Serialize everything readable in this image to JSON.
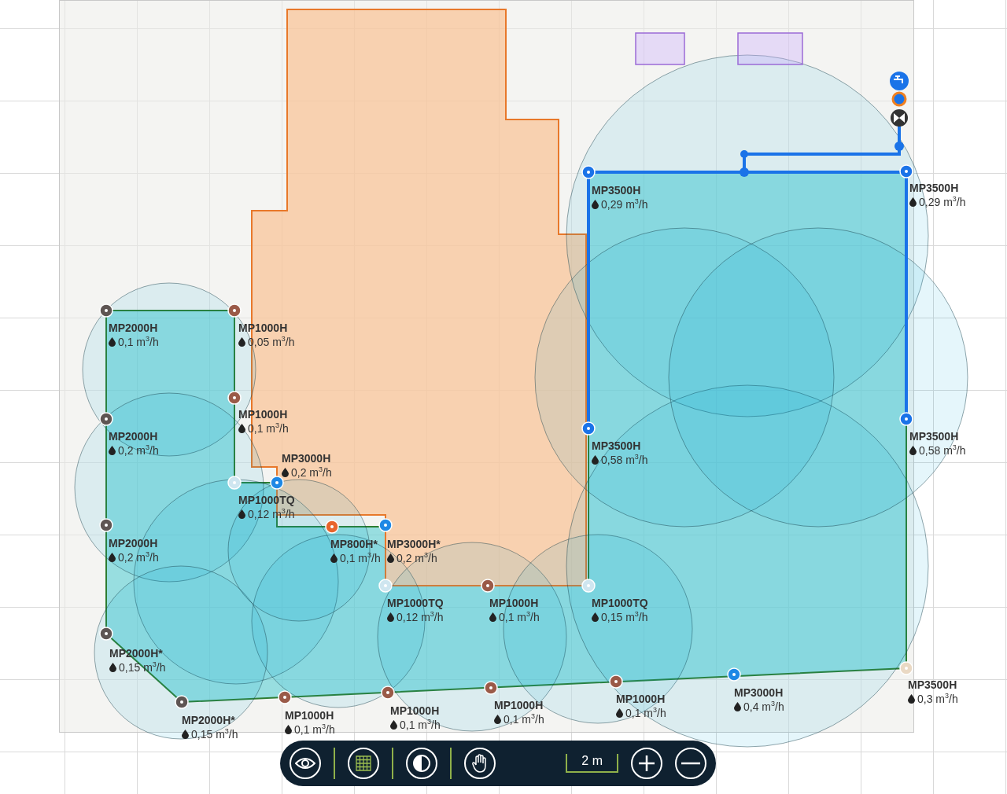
{
  "sprinklers": [
    {
      "model": "MP3500H",
      "flow": "0,29 m$^{3}$/h",
      "color": "#1a73e8"
    },
    {
      "model": "MP3500H",
      "flow": "0,29 m$^{3}$/h",
      "color": "#1a73e8"
    },
    {
      "model": "MP2000H",
      "flow": "0,1 m$^{3}$/h",
      "color": "#5e5553"
    },
    {
      "model": "MP1000H",
      "flow": "0,05 m$^{3}$/h",
      "color": "#9a5a48"
    },
    {
      "model": "MP1000H",
      "flow": "0,1 m$^{3}$/h",
      "color": "#9a5a48"
    },
    {
      "model": "MP2000H",
      "flow": "0,2 m$^{3}$/h",
      "color": "#5e5553"
    },
    {
      "model": "MP3500H",
      "flow": "0,58 m$^{3}$/h",
      "color": "#1a73e8"
    },
    {
      "model": "MP3500H",
      "flow": "0,58 m$^{3}$/h",
      "color": "#1a73e8"
    },
    {
      "model": "MP1000TQ",
      "flow": "0,12 m$^{3}$/h",
      "color": "#cfe6f0"
    },
    {
      "model": "MP3000H",
      "flow": "0,2 m$^{3}$/h",
      "color": "#1e88e5"
    },
    {
      "model": "MP2000H",
      "flow": "0,2 m$^{3}$/h",
      "color": "#5e5553"
    },
    {
      "model": "MP800H*",
      "flow": "0,1 m$^{3}$/h",
      "color": "#e8642c"
    },
    {
      "model": "MP3000H*",
      "flow": "0,2 m$^{3}$/h",
      "color": "#1e88e5"
    },
    {
      "model": "MP1000TQ",
      "flow": "0,12 m$^{3}$/h",
      "color": "#cfe6f0"
    },
    {
      "model": "MP1000H",
      "flow": "0,1 m$^{3}$/h",
      "color": "#9a5a48"
    },
    {
      "model": "MP1000TQ",
      "flow": "0,15 m$^{3}$/h",
      "color": "#cfe6f0"
    },
    {
      "model": "MP2000H*",
      "flow": "0,15 m$^{3}$/h",
      "color": "#5e5553"
    },
    {
      "model": "MP2000H*",
      "flow": "0,15 m$^{3}$/h",
      "color": "#5e5553"
    },
    {
      "model": "MP1000H",
      "flow": "0,1 m$^{3}$/h",
      "color": "#9a5a48"
    },
    {
      "model": "MP1000H",
      "flow": "0,1 m$^{3}$/h",
      "color": "#9a5a48"
    },
    {
      "model": "MP1000H",
      "flow": "0,1 m$^{3}$/h",
      "color": "#9a5a48"
    },
    {
      "model": "MP1000H",
      "flow": "0,1 m$^{3}$/h",
      "color": "#9a5a48"
    },
    {
      "model": "MP3000H",
      "flow": "0,4 m$^{3}$/h",
      "color": "#1e88e5"
    },
    {
      "model": "MP3500H",
      "flow": "0,3 m$^{3}$/h",
      "color": "#ead9c4"
    }
  ],
  "toolbar": {
    "tools": [
      {
        "kind": "eye"
      },
      {
        "kind": "grid"
      },
      {
        "kind": "contrast"
      },
      {
        "kind": "hand"
      }
    ],
    "scale": "2 m",
    "zoom": [
      {
        "kind": "in"
      },
      {
        "kind": "out"
      }
    ]
  }
}
